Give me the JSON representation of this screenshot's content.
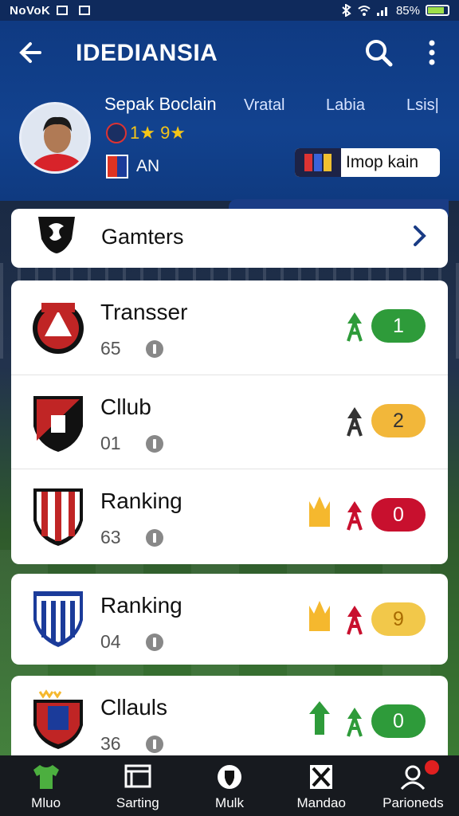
{
  "status": {
    "carrier": "NoVoK",
    "battery": "85%"
  },
  "header": {
    "title": "IDEDIANSIA",
    "player_name": "Sepak Boclain",
    "tabs": [
      "Vratal",
      "Labia",
      "Lsis|"
    ],
    "rating_text": "1★ 9★",
    "club_label": "AN",
    "promo_label": "Imop kain"
  },
  "gamers": {
    "label": "Gamters"
  },
  "rows": [
    {
      "name": "Transser",
      "number": "65",
      "pill": "1",
      "pill_color": "#2e9b3a",
      "arrow_color": "#2e9b3a",
      "crown": false
    },
    {
      "name": "Cllub",
      "number": "01",
      "pill": "2",
      "pill_color": "#f2b73a",
      "arrow_color": "#333333",
      "crown": false
    },
    {
      "name": "Ranking",
      "number": "63",
      "pill": "0",
      "pill_color": "#c8102e",
      "arrow_color": "#c8102e",
      "crown": true
    }
  ],
  "card4": {
    "name": "Ranking",
    "number": "04",
    "pill": "9",
    "pill_color": "#f2c84a"
  },
  "card5": {
    "name": "Cllauls",
    "number": "36",
    "pill": "0",
    "pill_color": "#2e9b3a"
  },
  "nav": [
    {
      "label": "Mluo",
      "icon": "jersey-icon"
    },
    {
      "label": "Sarting",
      "icon": "window-icon"
    },
    {
      "label": "Mulk",
      "icon": "shield-icon"
    },
    {
      "label": "Mandao",
      "icon": "bracket-icon"
    },
    {
      "label": "Parioneds",
      "icon": "profile-icon"
    }
  ]
}
